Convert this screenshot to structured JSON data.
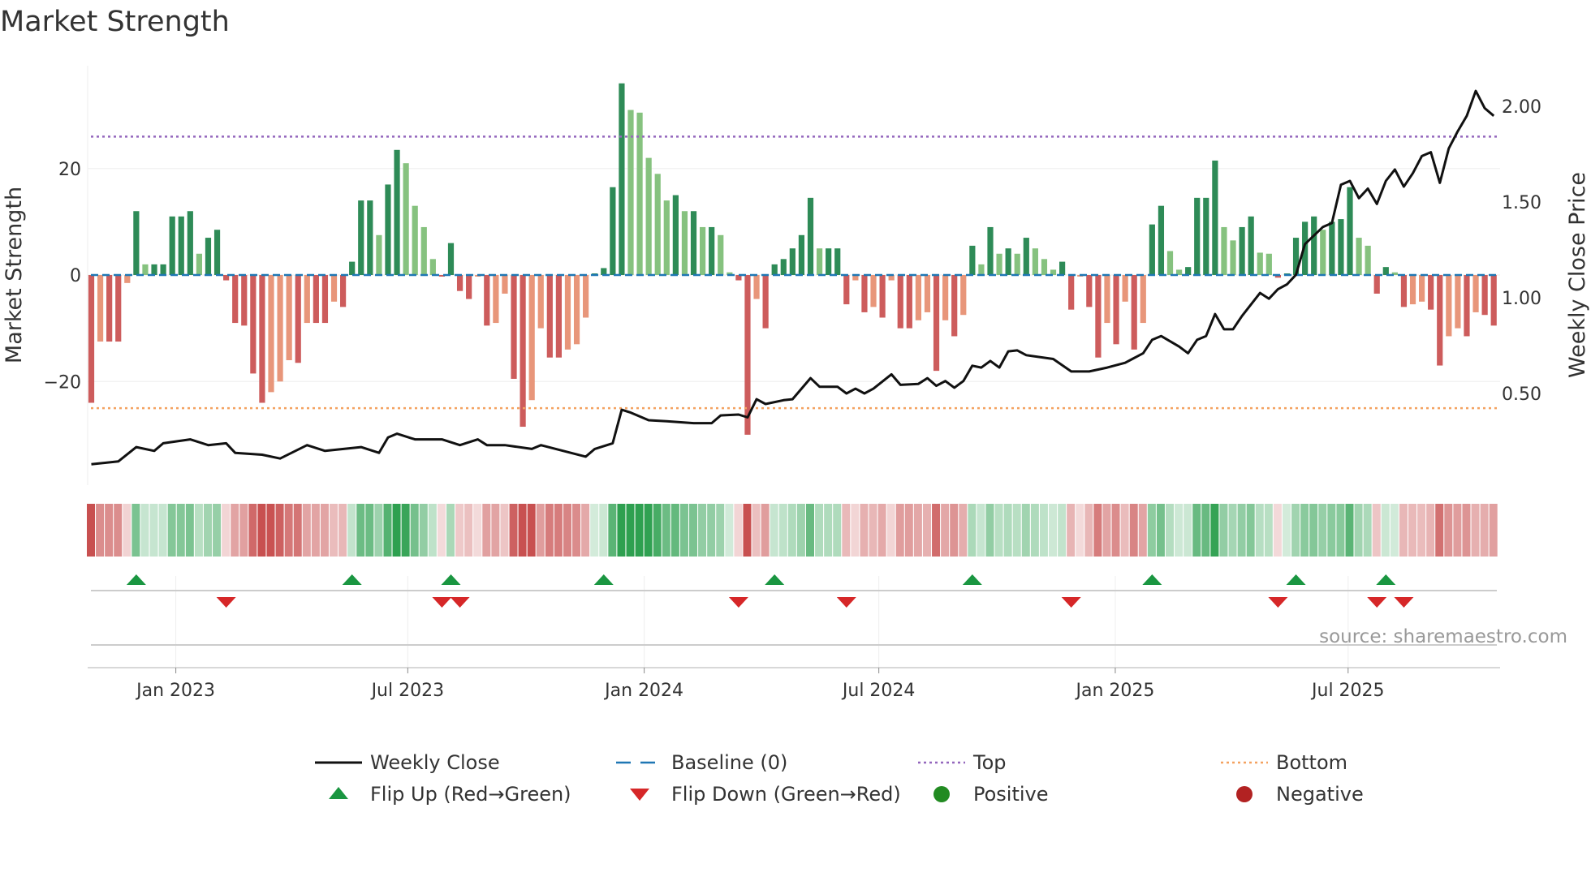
{
  "chart_data": {
    "type": "bar",
    "title": "Market Strength",
    "ylabel": "Market Strength",
    "y2label": "Weekly Close Price",
    "ylim": [
      -36,
      39
    ],
    "y2lim": [
      -0.16,
      2.24
    ],
    "yticks": [
      {
        "v": 20,
        "label": "20"
      },
      {
        "v": 0,
        "label": "0"
      },
      {
        "v": -20,
        "label": "−20"
      }
    ],
    "y2ticks": [
      {
        "v": 2.0,
        "label": "2.00"
      },
      {
        "v": 1.5,
        "label": "1.50"
      },
      {
        "v": 1.0,
        "label": "1.00"
      },
      {
        "v": 0.5,
        "label": "0.50"
      }
    ],
    "xticks": [
      {
        "week": 9.4,
        "label": "Jan 2023"
      },
      {
        "week": 35.2,
        "label": "Jul 2023"
      },
      {
        "week": 61.5,
        "label": "Jan 2024"
      },
      {
        "week": 87.6,
        "label": "Jul 2024"
      },
      {
        "week": 113.9,
        "label": "Jan 2025"
      },
      {
        "week": 139.8,
        "label": "Jul 2025"
      }
    ],
    "top_level": 26,
    "bottom_level": -25,
    "baseline": 0,
    "strength": [
      -24,
      -12.5,
      -12.5,
      -12.5,
      -1.5,
      12,
      2,
      2,
      2,
      11,
      11,
      12,
      4,
      7,
      8.5,
      -1,
      -9,
      -9.5,
      -18.5,
      -24,
      -22,
      -20,
      -16,
      -16.5,
      -9,
      -9,
      -9,
      -5,
      -6,
      2.5,
      14,
      14,
      7.5,
      17,
      23.5,
      21,
      13,
      9,
      3,
      -0.3,
      6,
      -3,
      -4.5,
      -0.3,
      -9.5,
      -9,
      -3.5,
      -19.5,
      -28.5,
      -23.5,
      -10,
      -15.5,
      -15.5,
      -14,
      -13,
      -8,
      0.3,
      1.3,
      16.5,
      36,
      31,
      30.5,
      22,
      19,
      14,
      15,
      12,
      12,
      9,
      9,
      7.5,
      0.5,
      -1,
      -30,
      -4.5,
      -10,
      2,
      3,
      5,
      7.5,
      14.5,
      5,
      5,
      5,
      -5.5,
      -1,
      -7,
      -6,
      -8,
      -1,
      -10,
      -10,
      -8.5,
      -7,
      -18,
      -8.5,
      -11.5,
      -7.5,
      5.5,
      2,
      9,
      4,
      5,
      4,
      7,
      5,
      3,
      1,
      2.5,
      -6.5,
      -0.3,
      -6,
      -15.5,
      -9,
      -13,
      -5,
      -14,
      -9,
      9.5,
      13,
      4.5,
      1,
      1.5,
      14.5,
      14.5,
      21.5,
      9,
      6.5,
      9,
      11,
      4.2,
      4,
      -0.5,
      0.3,
      7,
      10,
      11,
      8.5,
      10,
      10.5,
      16.5,
      7,
      5.5,
      -3.5,
      1.5,
      0.5,
      -6,
      -5.5,
      -5,
      -6.5,
      -17,
      -11.5,
      -10,
      -11.5,
      -7,
      -7.5,
      -9.5
    ],
    "weekly_close": [
      [
        0,
        0.13
      ],
      [
        3,
        0.145
      ],
      [
        5,
        0.22
      ],
      [
        7,
        0.2
      ],
      [
        8,
        0.24
      ],
      [
        11,
        0.26
      ],
      [
        13,
        0.23
      ],
      [
        15,
        0.24
      ],
      [
        16,
        0.19
      ],
      [
        19,
        0.18
      ],
      [
        21,
        0.16
      ],
      [
        24,
        0.23
      ],
      [
        26,
        0.2
      ],
      [
        30,
        0.22
      ],
      [
        32,
        0.19
      ],
      [
        33,
        0.27
      ],
      [
        34,
        0.29
      ],
      [
        36,
        0.26
      ],
      [
        39,
        0.26
      ],
      [
        41,
        0.23
      ],
      [
        43,
        0.26
      ],
      [
        44,
        0.23
      ],
      [
        46,
        0.23
      ],
      [
        49,
        0.21
      ],
      [
        50,
        0.23
      ],
      [
        55,
        0.17
      ],
      [
        56,
        0.21
      ],
      [
        58,
        0.24
      ],
      [
        59,
        0.415
      ],
      [
        60,
        0.4
      ],
      [
        62,
        0.36
      ],
      [
        64,
        0.355
      ],
      [
        67,
        0.345
      ],
      [
        69,
        0.345
      ],
      [
        70,
        0.385
      ],
      [
        72,
        0.39
      ],
      [
        73,
        0.375
      ],
      [
        74,
        0.47
      ],
      [
        75,
        0.445
      ],
      [
        77,
        0.465
      ],
      [
        78,
        0.47
      ],
      [
        80,
        0.58
      ],
      [
        81,
        0.535
      ],
      [
        83,
        0.535
      ],
      [
        84,
        0.5
      ],
      [
        85,
        0.525
      ],
      [
        86,
        0.5
      ],
      [
        87,
        0.525
      ],
      [
        89,
        0.6
      ],
      [
        90,
        0.545
      ],
      [
        92,
        0.55
      ],
      [
        93,
        0.58
      ],
      [
        94,
        0.54
      ],
      [
        95,
        0.565
      ],
      [
        96,
        0.53
      ],
      [
        97,
        0.565
      ],
      [
        98,
        0.645
      ],
      [
        99,
        0.635
      ],
      [
        100,
        0.67
      ],
      [
        101,
        0.635
      ],
      [
        102,
        0.72
      ],
      [
        103,
        0.725
      ],
      [
        104,
        0.7
      ],
      [
        107,
        0.68
      ],
      [
        109,
        0.615
      ],
      [
        111,
        0.615
      ],
      [
        113,
        0.635
      ],
      [
        115,
        0.66
      ],
      [
        117,
        0.71
      ],
      [
        118,
        0.78
      ],
      [
        119,
        0.8
      ],
      [
        121,
        0.745
      ],
      [
        122,
        0.71
      ],
      [
        123,
        0.78
      ],
      [
        124,
        0.8
      ],
      [
        125,
        0.915
      ],
      [
        126,
        0.835
      ],
      [
        127,
        0.835
      ],
      [
        128,
        0.905
      ],
      [
        130,
        1.025
      ],
      [
        131,
        0.995
      ],
      [
        132,
        1.045
      ],
      [
        133,
        1.07
      ],
      [
        134,
        1.12
      ],
      [
        135,
        1.28
      ],
      [
        137,
        1.37
      ],
      [
        138,
        1.39
      ],
      [
        139,
        1.59
      ],
      [
        140,
        1.61
      ],
      [
        141,
        1.52
      ],
      [
        142,
        1.57
      ],
      [
        143,
        1.49
      ],
      [
        144,
        1.61
      ],
      [
        145,
        1.67
      ],
      [
        146,
        1.58
      ],
      [
        147,
        1.65
      ],
      [
        148,
        1.74
      ],
      [
        149,
        1.76
      ],
      [
        150,
        1.6
      ],
      [
        151,
        1.78
      ],
      [
        152,
        1.87
      ],
      [
        153,
        1.95
      ],
      [
        154,
        2.08
      ],
      [
        155,
        1.99
      ],
      [
        156,
        1.95
      ]
    ],
    "flip_up_weeks": [
      5,
      29,
      40,
      57,
      76,
      98,
      118,
      134,
      144
    ],
    "flip_down_weeks": [
      15,
      39,
      41,
      72,
      84,
      109,
      132,
      143,
      146
    ],
    "legend": {
      "position": "bottom",
      "items": [
        {
          "key": "weekly_close",
          "label": "Weekly Close"
        },
        {
          "key": "baseline",
          "label": "Baseline (0)"
        },
        {
          "key": "top",
          "label": "Top"
        },
        {
          "key": "bottom",
          "label": "Bottom"
        },
        {
          "key": "flip_up",
          "label": "Flip Up (Red→Green)"
        },
        {
          "key": "flip_down",
          "label": "Flip Down (Green→Red)"
        },
        {
          "key": "positive",
          "label": "Positive"
        },
        {
          "key": "negative",
          "label": "Negative"
        }
      ]
    },
    "source": "source: sharemaestro.com",
    "colors": {
      "pos_strong": "#2e8b57",
      "pos_weak": "#86c27f",
      "neg_strong": "#cd5c5c",
      "neg_weak": "#e8967a",
      "price": "#111111",
      "baseline": "#1f77b4",
      "top": "#9467bd",
      "bottom": "#f4a261",
      "flip_up": "#1a9641",
      "flip_down": "#d62728",
      "positive": "#228b22",
      "negative": "#b22222"
    }
  }
}
